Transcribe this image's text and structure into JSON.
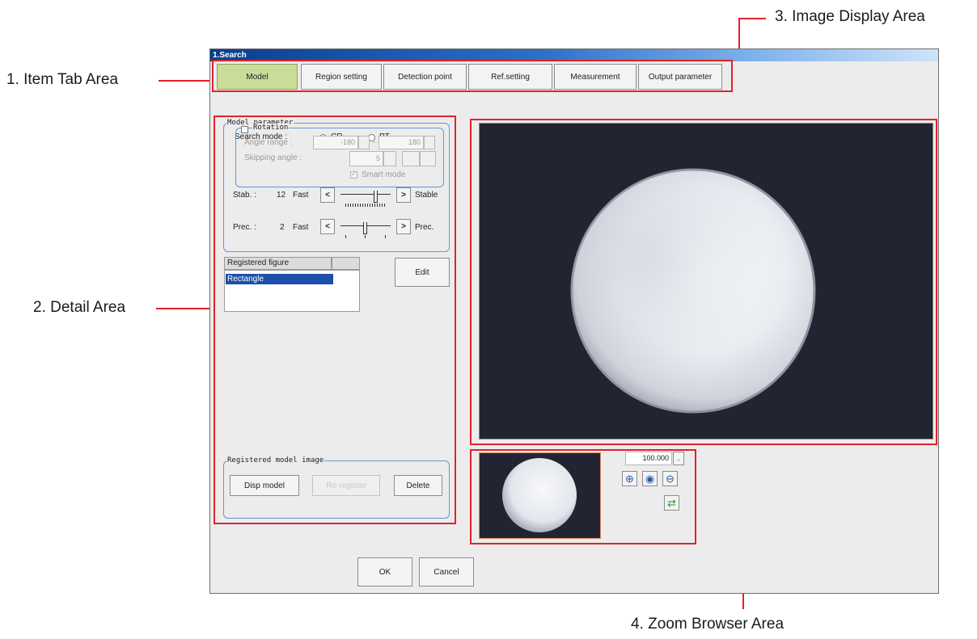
{
  "callouts": {
    "item_tab_area": "1. Item Tab Area",
    "detail_area": "2. Detail Area",
    "image_display_area": "3. Image Display Area",
    "zoom_browser_area": "4. Zoom Browser Area"
  },
  "window": {
    "title": "1.Search",
    "tabs": [
      "Model",
      "Region setting",
      "Detection point",
      "Ref.setting",
      "Measurement",
      "Output parameter"
    ],
    "active_tab": "Model"
  },
  "model_parameter": {
    "label": "Model parameter",
    "search_mode_label": "Search mode :",
    "mode_cr": "CR",
    "mode_pt": "PT",
    "selected_mode": "CR",
    "rotation": {
      "label": "Rotation",
      "checked": false,
      "angle_range_label": "Angle range :",
      "angle_min": "-180",
      "angle_sep": "-",
      "angle_max": "180",
      "skipping_angle_label": "Skipping angle :",
      "skipping_angle": "5",
      "smart_mode_label": "Smart mode",
      "smart_mode_checked": true
    },
    "stab": {
      "label": "Stab. :",
      "value": "12",
      "left": "Fast",
      "right": "Stable",
      "dec": "<",
      "inc": ">"
    },
    "prec": {
      "label": "Prec. :",
      "value": "2",
      "left": "Fast",
      "right": "Prec.",
      "dec": "<",
      "inc": ">"
    }
  },
  "registered_figure": {
    "header": "Registered figure",
    "items": [
      "Rectangle"
    ],
    "edit_button": "Edit"
  },
  "registered_model_image": {
    "label": "Registered model image",
    "disp_model": "Disp model",
    "middle_button": "Re-register",
    "delete": "Delete"
  },
  "zoom": {
    "value": "100.000",
    "dropdown": "..",
    "icons": [
      "zoom-in-icon",
      "zoom-fit-icon",
      "zoom-out-icon",
      "reload-icon"
    ]
  },
  "footer": {
    "ok": "OK",
    "cancel": "Cancel"
  },
  "colors": {
    "highlight_red": "#e0222a",
    "active_tab": "#c9dc9a",
    "group_border": "#5b9bd5",
    "title_blue": "#0a3e8e"
  }
}
